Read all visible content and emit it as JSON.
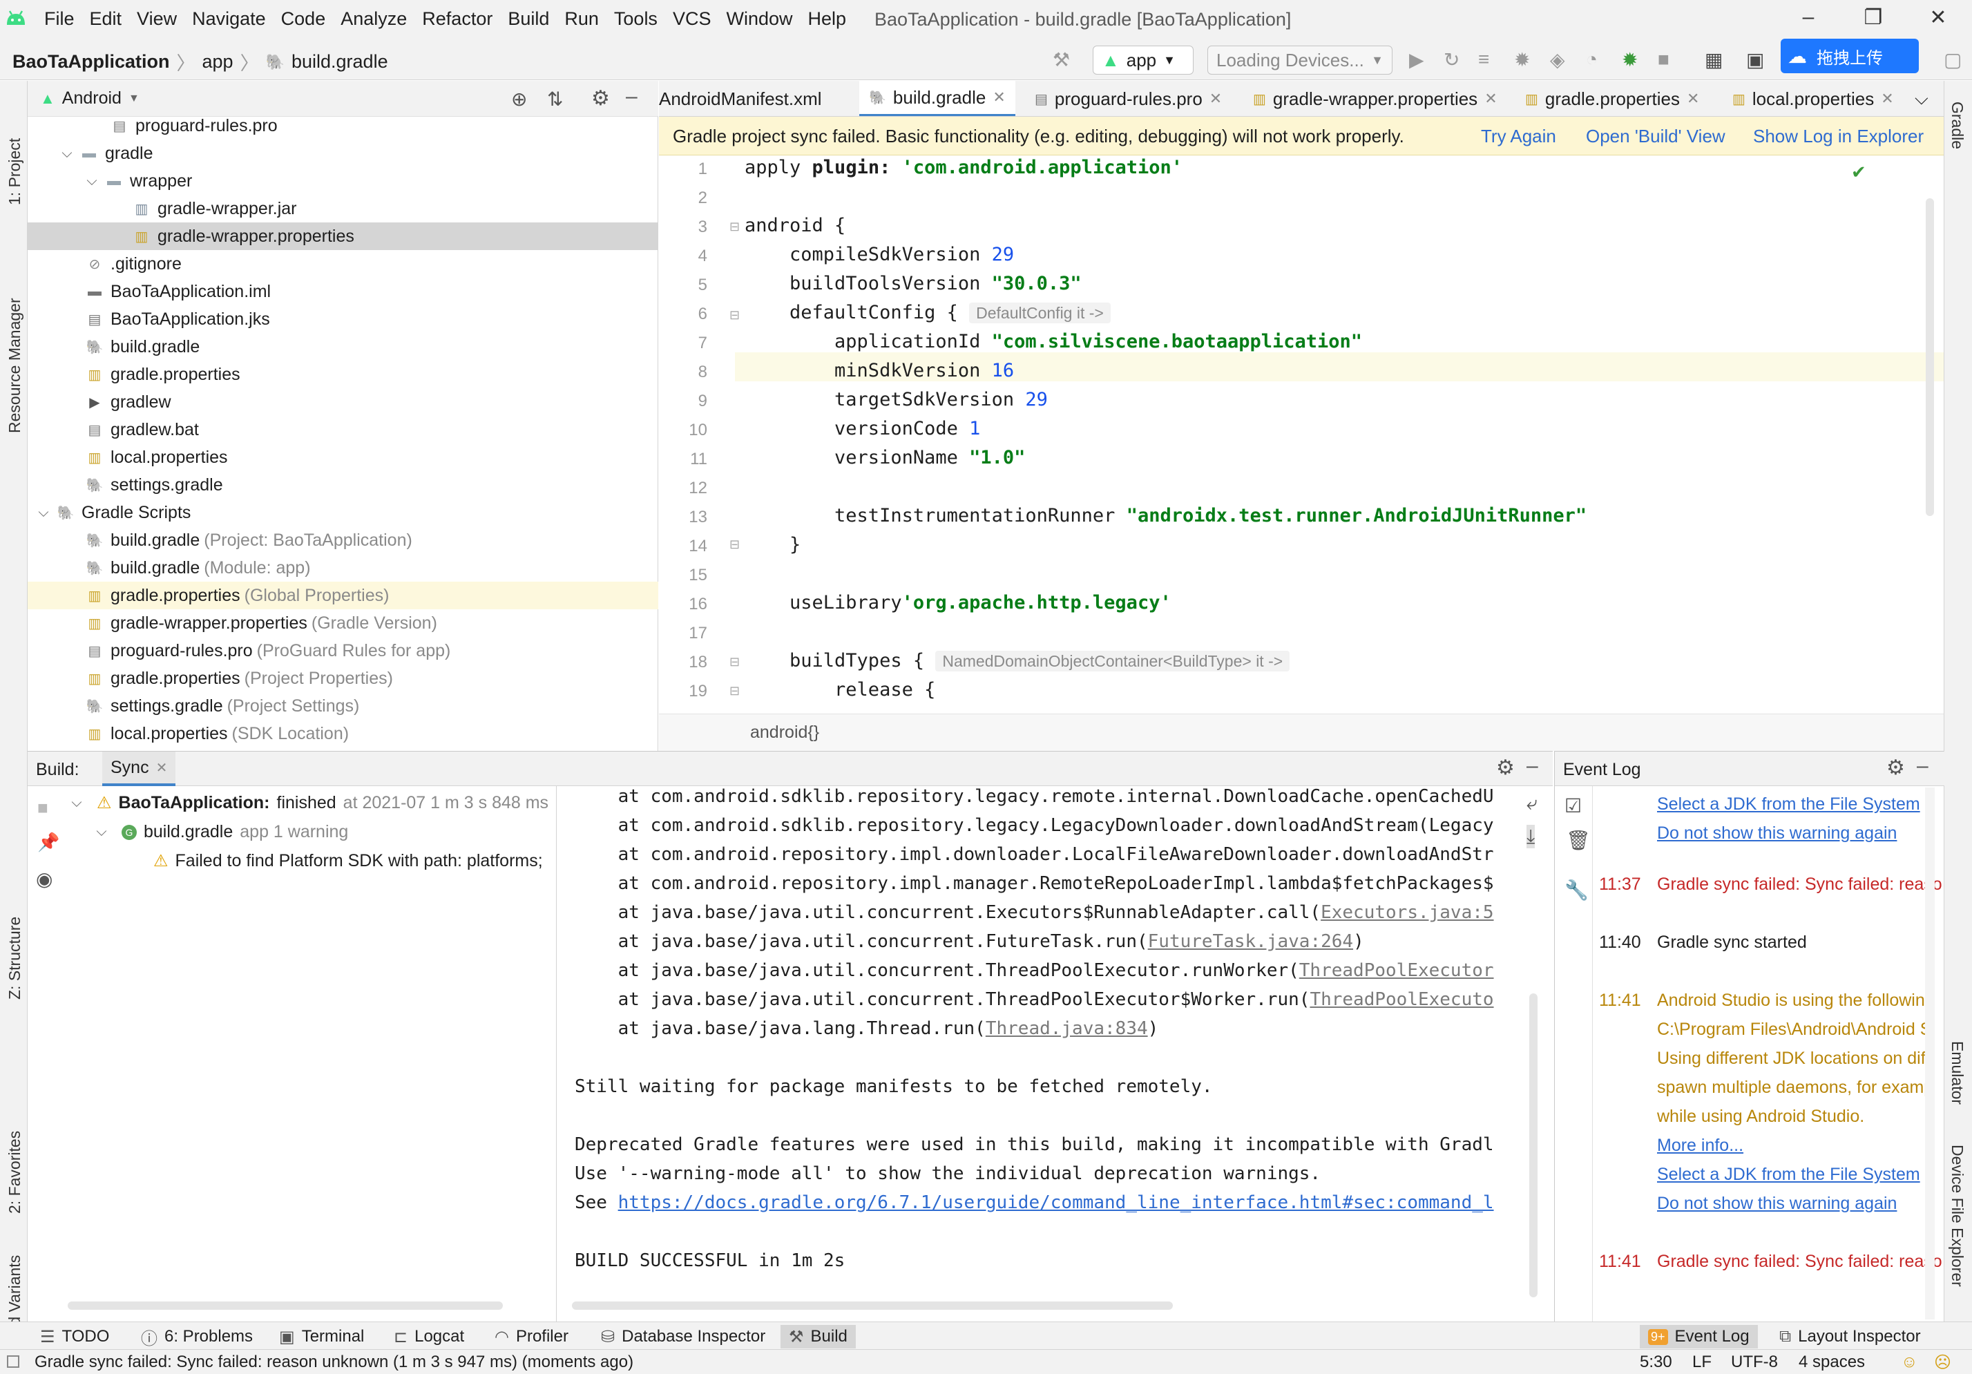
{
  "menubar": {
    "items": [
      "File",
      "Edit",
      "View",
      "Navigate",
      "Code",
      "Analyze",
      "Refactor",
      "Build",
      "Run",
      "Tools",
      "VCS",
      "Window",
      "Help"
    ],
    "title": "BaoTaApplication - build.gradle [BaoTaApplication]"
  },
  "navbar": {
    "crumbs": [
      "BaoTaApplication",
      "app",
      "build.gradle"
    ],
    "run_config": "app",
    "device": "Loading Devices...",
    "baidu_label": "拖拽上传"
  },
  "stripes": {
    "left": [
      "1: Project",
      "Resource Manager",
      "Z: Structure",
      "2: Favorites",
      "Build Variants"
    ],
    "right": [
      "Gradle",
      "Emulator",
      "Device File Explorer"
    ]
  },
  "project": {
    "view": "Android",
    "tree": [
      {
        "label": "proguard-rules.pro",
        "hint": "",
        "icon": "file-icon"
      },
      {
        "label": "gradle",
        "hint": "",
        "icon": "folder-icon"
      },
      {
        "label": "wrapper",
        "hint": "",
        "icon": "folder-icon"
      },
      {
        "label": "gradle-wrapper.jar",
        "hint": "",
        "icon": "jar-icon"
      },
      {
        "label": "gradle-wrapper.properties",
        "hint": "",
        "icon": "properties-icon"
      },
      {
        "label": ".gitignore",
        "hint": "",
        "icon": "gitignore-icon"
      },
      {
        "label": "BaoTaApplication.iml",
        "hint": "",
        "icon": "iml-icon"
      },
      {
        "label": "BaoTaApplication.jks",
        "hint": "",
        "icon": "file-icon"
      },
      {
        "label": "build.gradle",
        "hint": "",
        "icon": "gradle-icon"
      },
      {
        "label": "gradle.properties",
        "hint": "",
        "icon": "properties-icon"
      },
      {
        "label": "gradlew",
        "hint": "",
        "icon": "shell-icon"
      },
      {
        "label": "gradlew.bat",
        "hint": "",
        "icon": "file-icon"
      },
      {
        "label": "local.properties",
        "hint": "",
        "icon": "properties-icon"
      },
      {
        "label": "settings.gradle",
        "hint": "",
        "icon": "gradle-icon"
      },
      {
        "label": "Gradle Scripts",
        "hint": "",
        "icon": "gradle-icon"
      },
      {
        "label": "build.gradle",
        "hint": "(Project: BaoTaApplication)",
        "icon": "gradle-icon"
      },
      {
        "label": "build.gradle",
        "hint": "(Module: app)",
        "icon": "gradle-icon"
      },
      {
        "label": "gradle.properties",
        "hint": "(Global Properties)",
        "icon": "properties-icon"
      },
      {
        "label": "gradle-wrapper.properties",
        "hint": "(Gradle Version)",
        "icon": "properties-icon"
      },
      {
        "label": "proguard-rules.pro",
        "hint": "(ProGuard Rules for app)",
        "icon": "file-icon"
      },
      {
        "label": "gradle.properties",
        "hint": "(Project Properties)",
        "icon": "properties-icon"
      },
      {
        "label": "settings.gradle",
        "hint": "(Project Settings)",
        "icon": "gradle-icon"
      },
      {
        "label": "local.properties",
        "hint": "(SDK Location)",
        "icon": "properties-icon"
      }
    ]
  },
  "editor": {
    "tabs": [
      "AndroidManifest.xml",
      "build.gradle",
      "proguard-rules.pro",
      "gradle-wrapper.properties",
      "gradle.properties",
      "local.properties"
    ],
    "banner": {
      "message": "Gradle project sync failed. Basic functionality (e.g. editing, debugging) will not work properly.",
      "try_again": "Try Again",
      "open_build": "Open 'Build' View",
      "show_log": "Show Log in Explorer"
    },
    "line_numbers": [
      "1",
      "2",
      "3",
      "4",
      "5",
      "6",
      "7",
      "8",
      "9",
      "10",
      "11",
      "12",
      "13",
      "14",
      "15",
      "16",
      "17",
      "18",
      "19"
    ],
    "code": {
      "l1a": "apply ",
      "l1b": "plugin:",
      "l1c": " 'com.android.application'",
      "l3": "android {",
      "l4a": "    compileSdkVersion ",
      "l4b": "29",
      "l5a": "    buildToolsVersion ",
      "l5b": "\"30.0.3\"",
      "l6a": "    defaultConfig { ",
      "l6b": "DefaultConfig it ->",
      "l7a": "        applicationId ",
      "l7b": "\"com.silviscene.baotaapplication\"",
      "l8a": "        minSdkVersion ",
      "l8b": "16",
      "l9a": "        targetSdkVersion ",
      "l9b": "29",
      "l10a": "        versionCode ",
      "l10b": "1",
      "l11a": "        versionName ",
      "l11b": "\"1.0\"",
      "l13a": "        testInstrumentationRunner ",
      "l13b": "\"androidx.test.runner.AndroidJUnitRunner\"",
      "l14": "    }",
      "l16a": "    useLibrary",
      "l16b": "'org.apache.http.legacy'",
      "l18a": "    buildTypes { ",
      "l18b": "NamedDomainObjectContainer<BuildType> it ->",
      "l19": "        release {"
    },
    "breadcrumb": "android{}"
  },
  "build": {
    "title": "Build:",
    "tab": "Sync",
    "tree": {
      "root_name": "BaoTaApplication:",
      "root_status": "finished",
      "root_time": "at 2021-07 1 m 3 s 848 ms",
      "child_name": "build.gradle",
      "child_hint": "app 1 warning",
      "warning": "Failed to find Platform SDK with path: platforms;"
    },
    "console": [
      {
        "pre": "    at com.android.sdklib.repository.legacy.remote.internal.DownloadCache.openCachedU",
        "link": "",
        "post": ""
      },
      {
        "pre": "    at com.android.sdklib.repository.legacy.LegacyDownloader.downloadAndStream(Legacy",
        "link": "",
        "post": ""
      },
      {
        "pre": "    at com.android.repository.impl.downloader.LocalFileAwareDownloader.downloadAndStr",
        "link": "",
        "post": ""
      },
      {
        "pre": "    at com.android.repository.impl.manager.RemoteRepoLoaderImpl.lambda$fetchPackages$",
        "link": "",
        "post": ""
      },
      {
        "pre": "    at java.base/java.util.concurrent.Executors$RunnableAdapter.call(",
        "link": "Executors.java:5",
        "post": ""
      },
      {
        "pre": "    at java.base/java.util.concurrent.FutureTask.run(",
        "link": "FutureTask.java:264",
        "post": ")"
      },
      {
        "pre": "    at java.base/java.util.concurrent.ThreadPoolExecutor.runWorker(",
        "link": "ThreadPoolExecutor",
        "post": ""
      },
      {
        "pre": "    at java.base/java.util.concurrent.ThreadPoolExecutor$Worker.run(",
        "link": "ThreadPoolExecuto",
        "post": ""
      },
      {
        "pre": "    at java.base/java.lang.Thread.run(",
        "link": "Thread.java:834",
        "post": ")"
      },
      {
        "pre": "",
        "link": "",
        "post": ""
      },
      {
        "pre": "Still waiting for package manifests to be fetched remotely.",
        "link": "",
        "post": ""
      },
      {
        "pre": "",
        "link": "",
        "post": ""
      },
      {
        "pre": "Deprecated Gradle features were used in this build, making it incompatible with Gradl",
        "link": "",
        "post": ""
      },
      {
        "pre": "Use '--warning-mode all' to show the individual deprecation warnings.",
        "link": "",
        "post": ""
      },
      {
        "pre": "See ",
        "link": "https://docs.gradle.org/6.7.1/userguide/command_line_interface.html#sec:command_l",
        "post": ""
      },
      {
        "pre": "",
        "link": "",
        "post": ""
      },
      {
        "pre": "BUILD SUCCESSFUL in 1m 2s",
        "link": "",
        "post": ""
      }
    ]
  },
  "eventlog": {
    "title": "Event Log",
    "entries": [
      {
        "time": "",
        "text": "Select a JDK from the File System",
        "kind": "blue"
      },
      {
        "time": "",
        "text": "Do not show this warning again",
        "kind": "blue"
      },
      {
        "time": "11:37",
        "text": "Gradle sync failed: Sync failed: reaso",
        "kind": "red"
      },
      {
        "time": "11:40",
        "text": "Gradle sync started",
        "kind": "normal"
      },
      {
        "time": "11:41",
        "text": "Android Studio is using the followin",
        "kind": "orange"
      },
      {
        "time": "",
        "text": "C:\\Program Files\\Android\\Android S",
        "kind": "orange"
      },
      {
        "time": "",
        "text": "Using different JDK locations on diff",
        "kind": "orange"
      },
      {
        "time": "",
        "text": "spawn multiple daemons, for examp",
        "kind": "orange"
      },
      {
        "time": "",
        "text": "while using Android Studio.",
        "kind": "orange"
      },
      {
        "time": "",
        "text": "More info...",
        "kind": "blue"
      },
      {
        "time": "",
        "text": "Select a JDK from the File System",
        "kind": "blue"
      },
      {
        "time": "",
        "text": "Do not show this warning again",
        "kind": "blue"
      },
      {
        "time": "11:41",
        "text": "Gradle sync failed: Sync failed: reaso",
        "kind": "red"
      }
    ]
  },
  "bottom_tabs": {
    "todo": "TODO",
    "problems": "6: Problems",
    "terminal": "Terminal",
    "logcat": "Logcat",
    "profiler": "Profiler",
    "database": "Database Inspector",
    "build": "Build",
    "event_badge": "9+",
    "event_log": "Event Log",
    "layout_inspector": "Layout Inspector"
  },
  "status": {
    "message": "Gradle sync failed: Sync failed: reason unknown (1 m 3 s 947 ms) (moments ago)",
    "position": "5:30",
    "line_sep": "LF",
    "encoding": "UTF-8",
    "indent": "4 spaces"
  },
  "colors": {
    "accent": "#4083c9",
    "string": "#067d17",
    "number": "#1750eb",
    "error": "#c62828",
    "warning": "#b8860b",
    "android": "#3ddc84"
  }
}
